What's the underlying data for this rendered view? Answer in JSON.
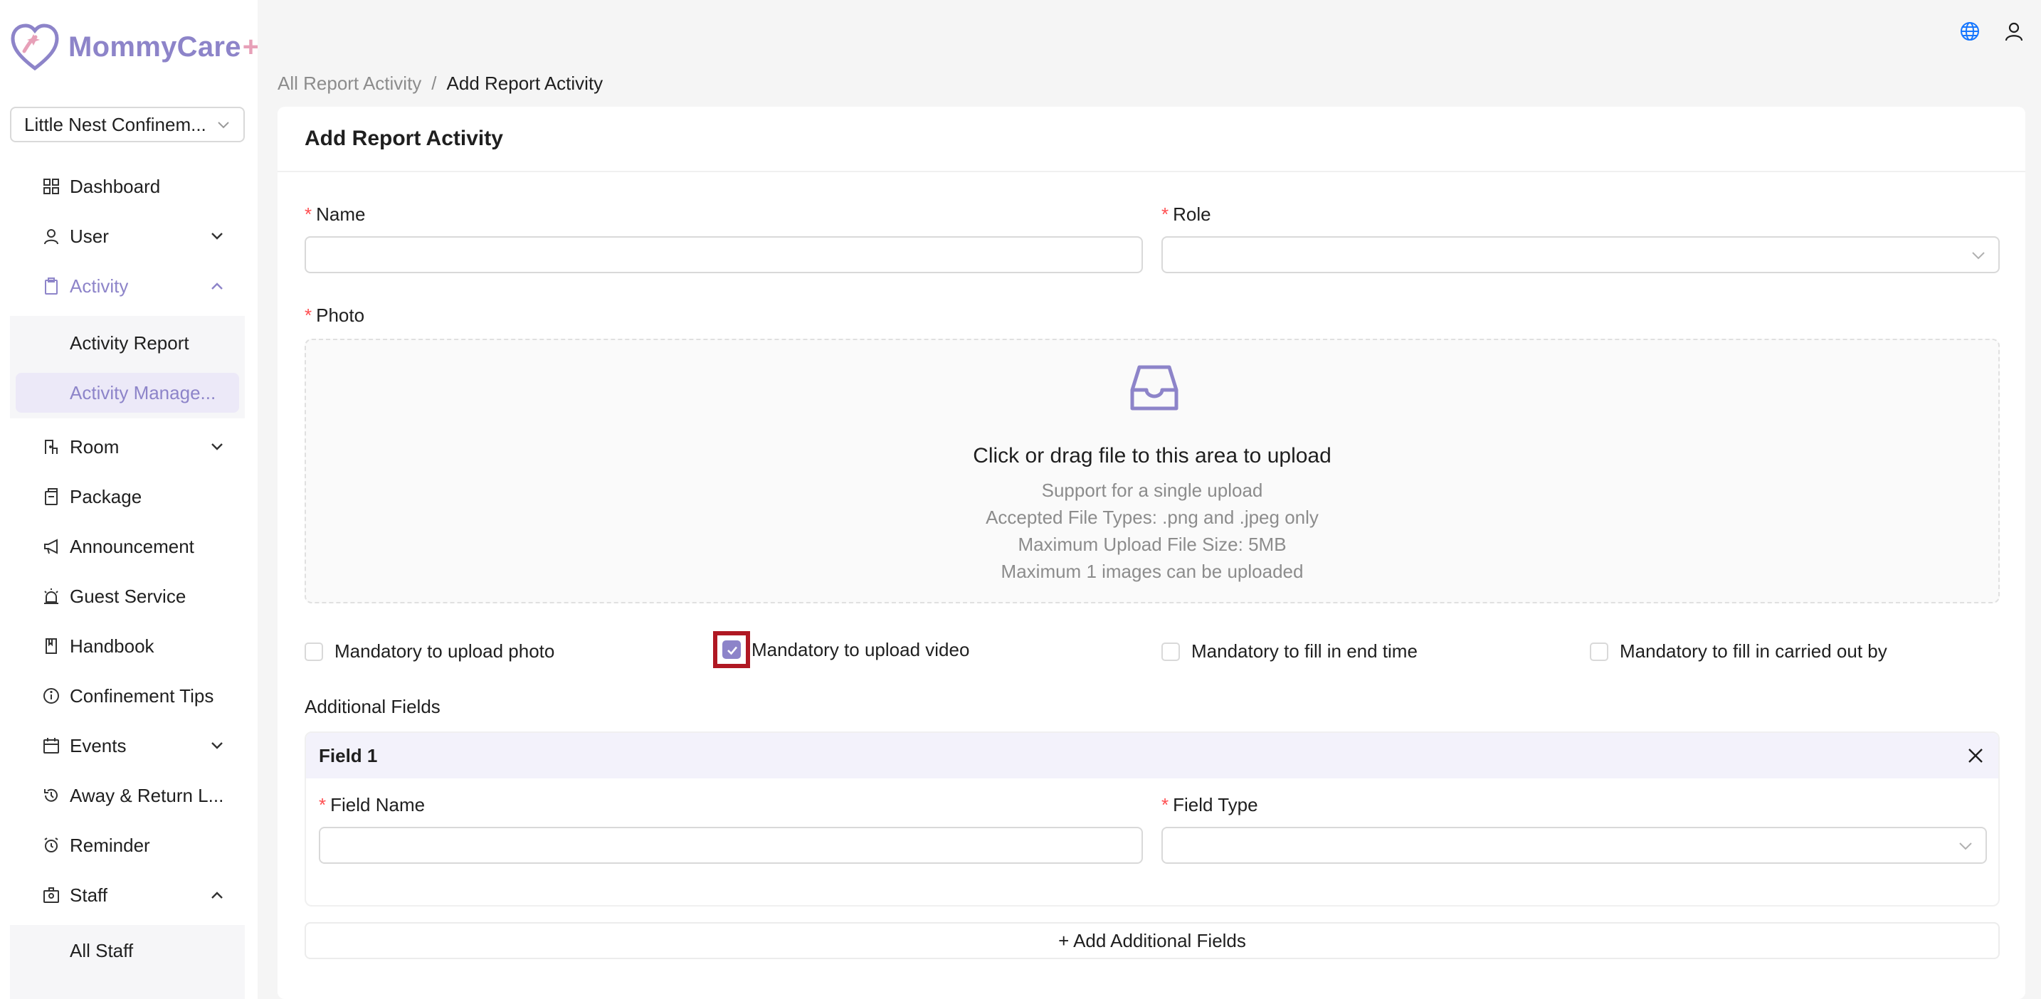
{
  "brand": {
    "name": "MommyCare",
    "plus": "+",
    "accent": "#8d84c9",
    "pink": "#e7a0b8"
  },
  "facility": {
    "selected": "Little Nest Confinem..."
  },
  "nav": {
    "dashboard": "Dashboard",
    "user": "User",
    "activity": "Activity",
    "activity_report": "Activity Report",
    "activity_management": "Activity Manage...",
    "room": "Room",
    "package": "Package",
    "announcement": "Announcement",
    "guest_service": "Guest Service",
    "handbook": "Handbook",
    "confinement_tips": "Confinement Tips",
    "events": "Events",
    "away_return": "Away & Return L...",
    "reminder": "Reminder",
    "staff": "Staff",
    "all_staff": "All Staff"
  },
  "breadcrumb": {
    "parent": "All Report Activity",
    "separator": "/",
    "current": "Add Report Activity"
  },
  "form": {
    "title": "Add Report Activity",
    "required_mark": "*",
    "name_label": "Name",
    "name_value": "",
    "role_label": "Role",
    "role_value": "",
    "photo_label": "Photo",
    "upload": {
      "main": "Click or drag file to this area to upload",
      "hint1": "Support for a single upload",
      "hint2": "Accepted File Types: .png and .jpeg only",
      "hint3": "Maximum Upload File Size: 5MB",
      "hint4": "Maximum 1 images can be uploaded"
    },
    "checkboxes": {
      "photo": {
        "label": "Mandatory to upload photo",
        "checked": false
      },
      "video": {
        "label": "Mandatory to upload video",
        "checked": true
      },
      "end_time": {
        "label": "Mandatory to fill in end time",
        "checked": false
      },
      "carried_out": {
        "label": "Mandatory to fill in carried out by",
        "checked": false
      }
    },
    "additional_fields_title": "Additional Fields",
    "field1": {
      "title": "Field 1",
      "name_label": "Field Name",
      "name_value": "",
      "type_label": "Field Type",
      "type_value": ""
    },
    "add_button": "+ Add Additional Fields"
  },
  "icons": {
    "globe": "globe-icon",
    "user": "user-icon",
    "inbox": "inbox-icon",
    "close": "close-icon"
  }
}
